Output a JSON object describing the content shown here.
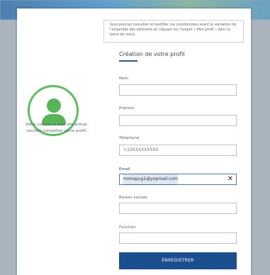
{
  "left_panel": {
    "message": "Votre compte a bien été activé, veuillez compléter votre profil."
  },
  "info": {
    "text": "Vous pourrez consulter et modifier ces coordonnées avant la validation de l'ensemble des éléments en cliquant sur l'onglet « Mon profil » dans la barre de menu"
  },
  "form": {
    "title": "Création de votre profil",
    "fields": {
      "nom": {
        "label": "Nom",
        "value": ""
      },
      "prenom": {
        "label": "Prénom",
        "value": ""
      },
      "telephone": {
        "label": "Téléphone",
        "placeholder": "+33XXXXXXXXX"
      },
      "email": {
        "label": "Email",
        "value": "monopug1@yopmail.com",
        "clear": "✕"
      },
      "raison_sociale": {
        "label": "Raison sociale",
        "value": ""
      },
      "fonction": {
        "label": "Fonction",
        "value": ""
      }
    },
    "submit_label": "ENREGISTRER"
  },
  "colors": {
    "primary": "#1c4f8f",
    "accent_green": "#5cbf5c"
  }
}
